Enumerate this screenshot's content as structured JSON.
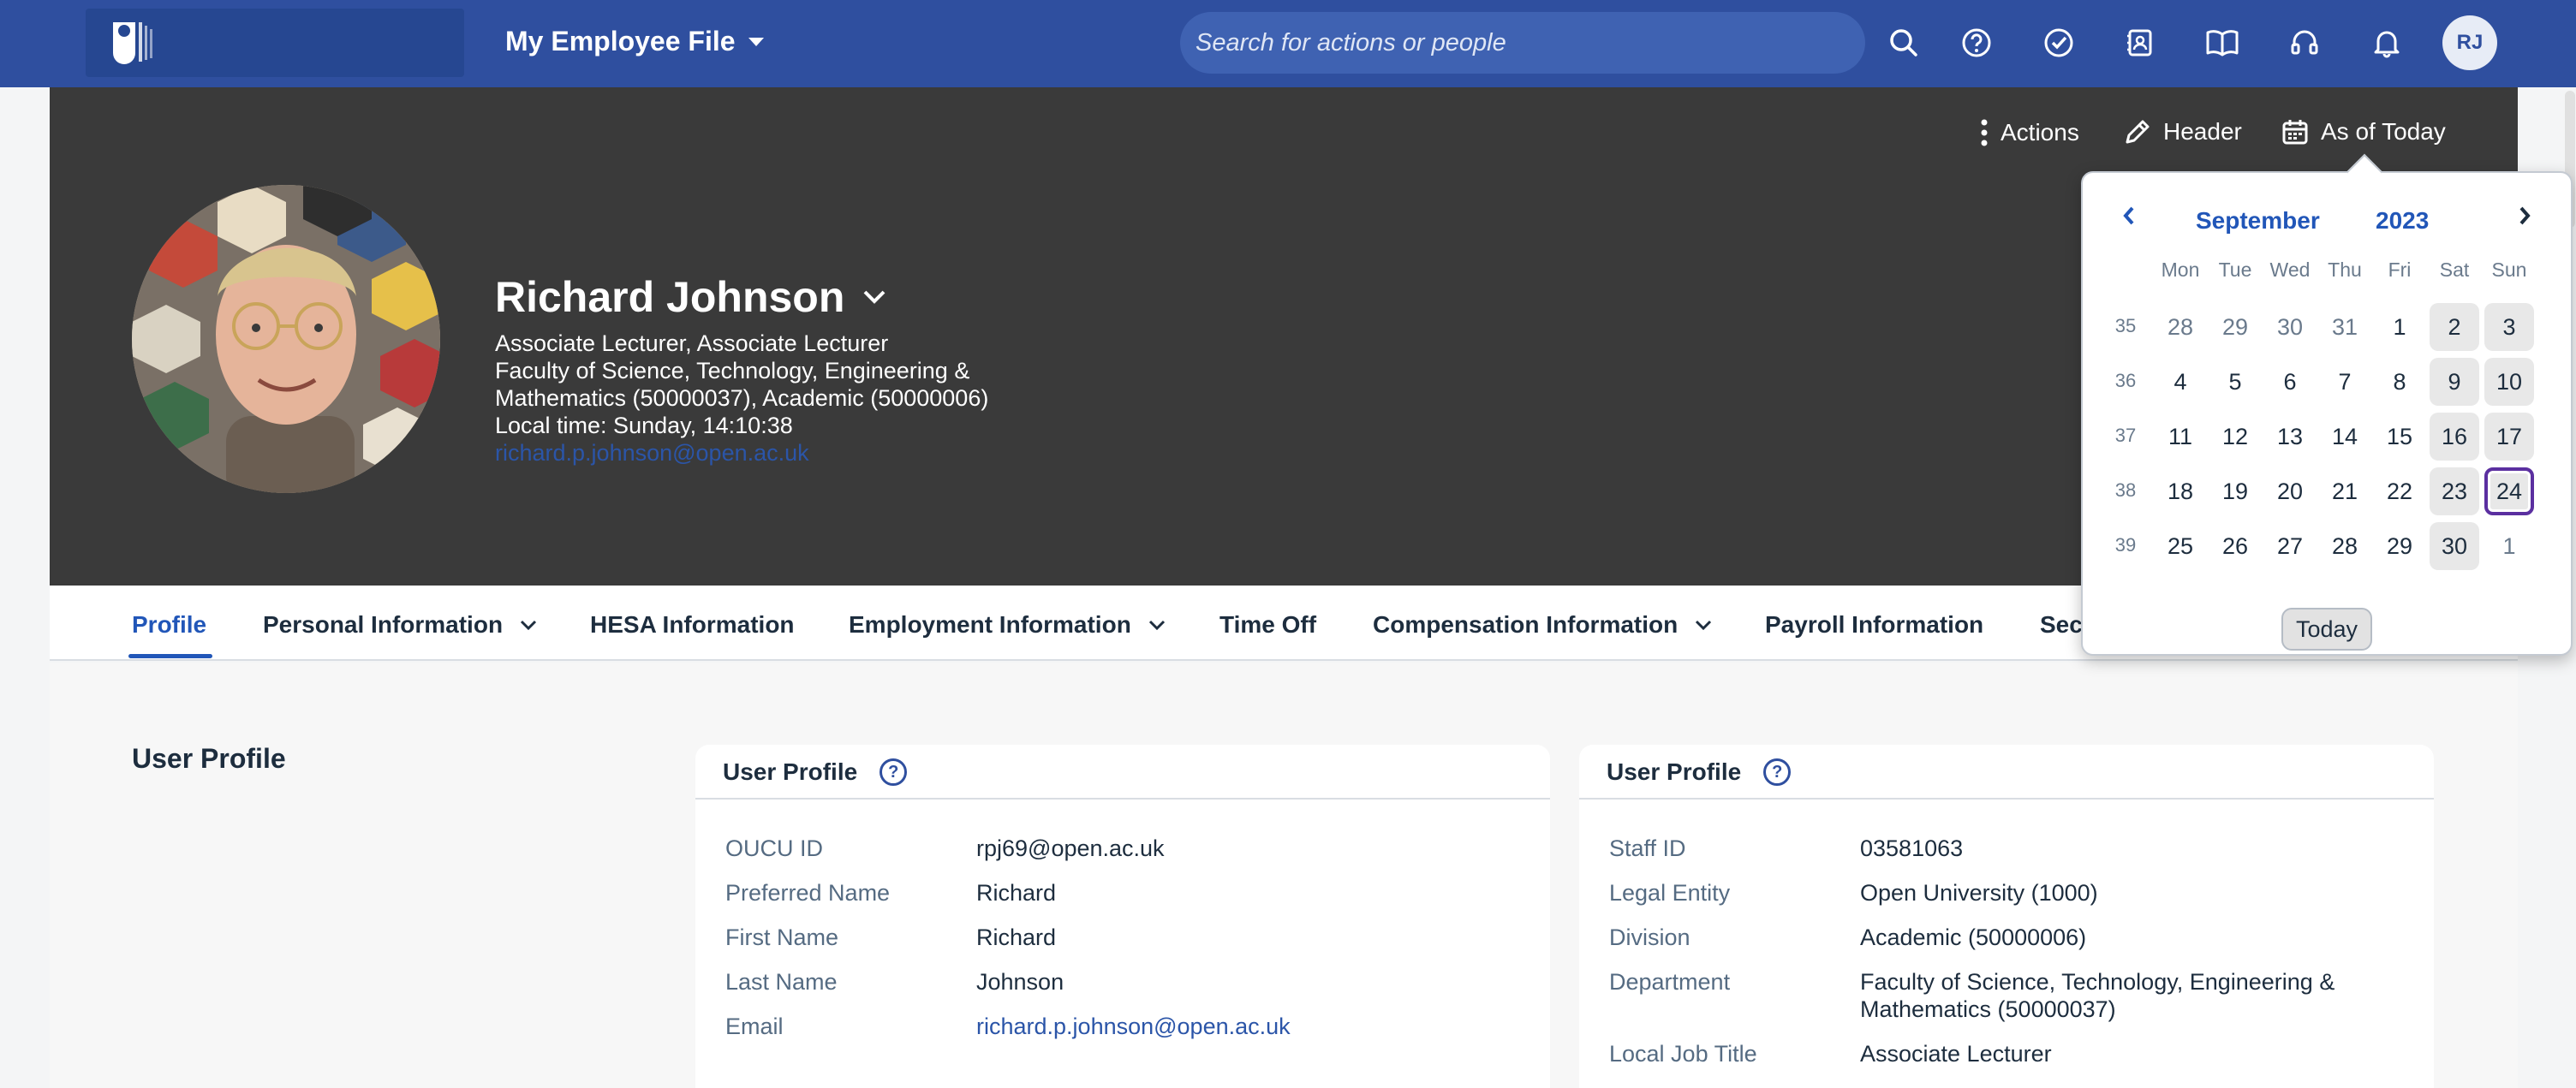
{
  "shell": {
    "app_title": "My Employee File",
    "search_placeholder": "Search for actions or people",
    "user_initials": "RJ",
    "icons": [
      "search-icon",
      "help-icon",
      "approvals-icon",
      "contacts-icon",
      "learning-icon",
      "headset-icon",
      "notifications-icon"
    ]
  },
  "header_actions": {
    "actions_label": "Actions",
    "header_label": "Header",
    "as_of_label": "As of Today"
  },
  "employee": {
    "name": "Richard Johnson",
    "title_line": "Associate Lecturer, Associate Lecturer",
    "org_line_1": "Faculty of Science, Technology, Engineering &",
    "org_line_2": "Mathematics (50000037), Academic (50000006)",
    "local_time": "Local time: Sunday, 14:10:38",
    "email": "richard.p.johnson@open.ac.uk"
  },
  "tabs": [
    {
      "label": "Profile",
      "active": true
    },
    {
      "label": "Personal Information",
      "dropdown": true
    },
    {
      "label": "HESA Information"
    },
    {
      "label": "Employment Information",
      "dropdown": true
    },
    {
      "label": "Time Off"
    },
    {
      "label": "Compensation Information",
      "dropdown": true
    },
    {
      "label": "Payroll Information"
    },
    {
      "label": "Sec"
    }
  ],
  "section": {
    "title": "User Profile"
  },
  "card_left": {
    "title": "User Profile",
    "fields": [
      {
        "label": "OUCU ID",
        "value": "rpj69@open.ac.uk"
      },
      {
        "label": "Preferred Name",
        "value": "Richard"
      },
      {
        "label": "First Name",
        "value": "Richard"
      },
      {
        "label": "Last Name",
        "value": "Johnson"
      },
      {
        "label": "Email",
        "value": "richard.p.johnson@open.ac.uk"
      }
    ]
  },
  "card_right": {
    "title": "User Profile",
    "fields": [
      {
        "label": "Staff ID",
        "value": "03581063"
      },
      {
        "label": "Legal Entity",
        "value": "Open University (1000)"
      },
      {
        "label": "Division",
        "value": "Academic (50000006)"
      },
      {
        "label": "Department",
        "value": "Faculty of Science, Technology, Engineering &",
        "value_2": "Mathematics (50000037)"
      },
      {
        "label": "Local Job Title",
        "value": "Associate Lecturer"
      }
    ]
  },
  "calendar": {
    "month": "September",
    "year": "2023",
    "weekdays": [
      "Mon",
      "Tue",
      "Wed",
      "Thu",
      "Fri",
      "Sat",
      "Sun"
    ],
    "weeks": [
      {
        "num": "35",
        "days": [
          "28",
          "29",
          "30",
          "31",
          "1",
          "2",
          "3"
        ]
      },
      {
        "num": "36",
        "days": [
          "4",
          "5",
          "6",
          "7",
          "8",
          "9",
          "10"
        ]
      },
      {
        "num": "37",
        "days": [
          "11",
          "12",
          "13",
          "14",
          "15",
          "16",
          "17"
        ]
      },
      {
        "num": "38",
        "days": [
          "18",
          "19",
          "20",
          "21",
          "22",
          "23",
          "24"
        ]
      },
      {
        "num": "39",
        "days": [
          "25",
          "26",
          "27",
          "28",
          "29",
          "30",
          "1"
        ]
      }
    ],
    "selected_day": "24",
    "today_label": "Today"
  },
  "colors": {
    "shell": "#2f4f9f",
    "hero": "#3a3a3a",
    "accent": "#2156b8",
    "selected_outline": "#5b2fa0"
  }
}
